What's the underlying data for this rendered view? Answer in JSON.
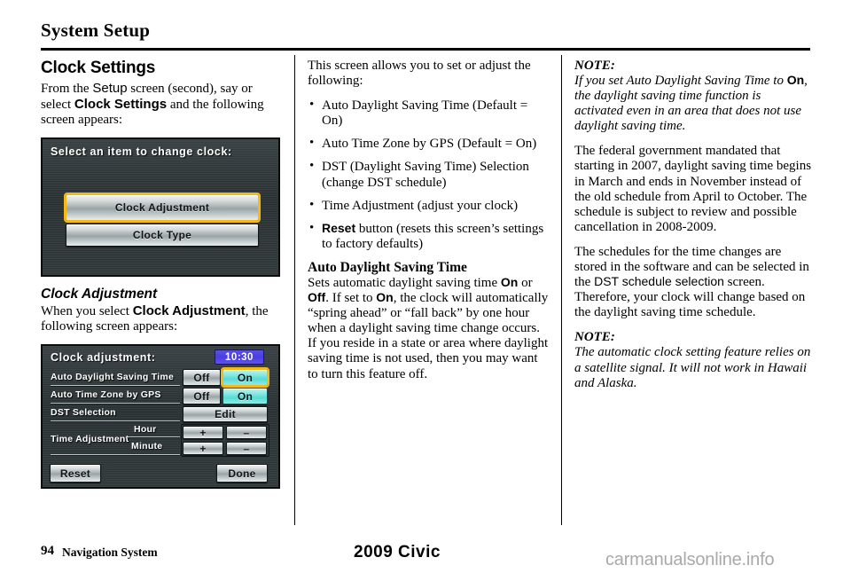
{
  "page": {
    "title": "System Setup",
    "footer_page_number": "94",
    "footer_section": "Navigation System",
    "footer_model": "2009  Civic",
    "watermark": "carmanualsonline.info"
  },
  "left_column": {
    "heading": "Clock Settings",
    "intro_part1": "From the ",
    "intro_setup": "Setup",
    "intro_part2": " screen (second), say or select ",
    "intro_clock_settings": "Clock Settings",
    "intro_part3": " and the following screen appears:",
    "screen_clock_settings": {
      "title": "Select an item to change clock:",
      "buttons": [
        {
          "label": "Clock Adjustment",
          "selected": true
        },
        {
          "label": "Clock Type",
          "selected": false
        }
      ]
    },
    "subheading": "Clock Adjustment",
    "sub_part1": "When you select ",
    "sub_clock_adjustment": "Clock Adjustment",
    "sub_part2": ", the following screen appears:",
    "screen_clock_adjust": {
      "title": "Clock adjustment:",
      "time": "10:30",
      "rows": [
        {
          "label": "Auto Daylight Saving Time",
          "off": "Off",
          "on": "On",
          "on_selected": true,
          "highlighted": true
        },
        {
          "label": "Auto Time Zone by GPS",
          "off": "Off",
          "on": "On",
          "on_selected": true,
          "highlighted": false
        },
        {
          "label": "DST Selection",
          "action": "Edit"
        },
        {
          "label": "Time Adjustment",
          "sub1": "Hour",
          "sub2": "Minute",
          "plus": "+",
          "minus": "–"
        }
      ],
      "reset": "Reset",
      "done": "Done"
    }
  },
  "middle_column": {
    "intro": "This screen allows you to set or adjust the following:",
    "bullets": [
      {
        "text": "Auto Daylight Saving Time (Default = On)"
      },
      {
        "text": "Auto Time Zone by GPS (Default = On)"
      },
      {
        "text": "DST (Daylight Saving Time) Selection (change DST schedule)"
      },
      {
        "text": "Time Adjustment (adjust your clock)"
      },
      {
        "bold_prefix": "Reset",
        "text": " button (resets this screen’s settings to factory defaults)"
      }
    ],
    "section_heading": "Auto Daylight Saving Time",
    "body_p1": "Sets automatic daylight saving time ",
    "body_on1": "On",
    "body_p2": " or ",
    "body_off": "Off",
    "body_p3": ". If set to ",
    "body_on2": "On",
    "body_p4": ", the clock will automatically “spring ahead” or “fall back” by one hour when a daylight saving time change occurs. If you reside in a state or area where daylight saving time is not used, then you may want to turn this feature off."
  },
  "right_column": {
    "note1_label": "NOTE:",
    "note1_p1": "If you set Auto Daylight Saving Time to ",
    "note1_on": "On",
    "note1_p2": ", the daylight saving time function is activated even in an area that does not use daylight saving time.",
    "para_federal": "The federal government mandated that starting in 2007, daylight saving time begins in March and ends in November instead of the old schedule from April to October. The schedule is subject to review and possible cancellation in 2008-2009.",
    "para_sched_p1": "The schedules for the time changes are stored in the software and can be selected in the ",
    "para_sched_dst": "DST schedule selection",
    "para_sched_p2": " screen. Therefore, your clock will change based on the daylight saving time schedule.",
    "note2_label": "NOTE:",
    "note2_text": "The automatic clock setting feature relies on a satellite signal. It will not work in Hawaii and Alaska."
  }
}
